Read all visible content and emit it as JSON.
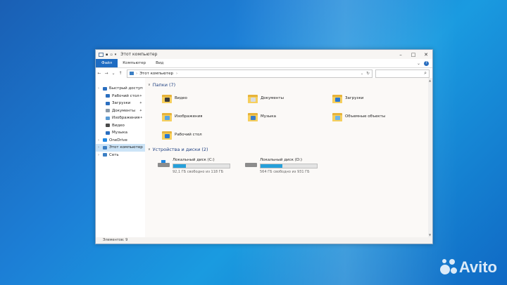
{
  "window": {
    "title": "Этот компьютер",
    "ribbon_tabs": [
      "Файл",
      "Компьютер",
      "Вид"
    ],
    "address": "Этот компьютер",
    "status": "Элементов: 9"
  },
  "nav": {
    "items": [
      {
        "label": "Быстрый доступ",
        "icon": "star-icon",
        "color": "#2b6fc0",
        "child": false,
        "pinned": false,
        "selected": false,
        "arrow": "›"
      },
      {
        "label": "Рабочий стол",
        "icon": "desktop-icon",
        "color": "#2b6fc0",
        "child": true,
        "pinned": true,
        "selected": false,
        "arrow": ""
      },
      {
        "label": "Загрузки",
        "icon": "download-icon",
        "color": "#2b6fc0",
        "child": true,
        "pinned": true,
        "selected": false,
        "arrow": ""
      },
      {
        "label": "Документы",
        "icon": "documents-icon",
        "color": "#8c9aa8",
        "child": true,
        "pinned": true,
        "selected": false,
        "arrow": ""
      },
      {
        "label": "Изображения",
        "icon": "pictures-icon",
        "color": "#5a9bd5",
        "child": true,
        "pinned": true,
        "selected": false,
        "arrow": ""
      },
      {
        "label": "Видео",
        "icon": "video-icon",
        "color": "#4a4a4a",
        "child": true,
        "pinned": false,
        "selected": false,
        "arrow": ""
      },
      {
        "label": "Музыка",
        "icon": "music-icon",
        "color": "#2b6fc0",
        "child": true,
        "pinned": false,
        "selected": false,
        "arrow": ""
      },
      {
        "label": "OneDrive",
        "icon": "cloud-icon",
        "color": "#1e88e5",
        "child": false,
        "pinned": false,
        "selected": false,
        "arrow": "›"
      },
      {
        "label": "Этот компьютер",
        "icon": "computer-icon",
        "color": "#3c7fc4",
        "child": false,
        "pinned": false,
        "selected": true,
        "arrow": "›"
      },
      {
        "label": "Сеть",
        "icon": "network-icon",
        "color": "#3c7fc4",
        "child": false,
        "pinned": false,
        "selected": false,
        "arrow": "›"
      }
    ]
  },
  "folders_section": {
    "title": "Папки (7)",
    "items": [
      {
        "label": "Видео",
        "icon": "video-folder-icon",
        "badge": "#3b3b3b"
      },
      {
        "label": "Документы",
        "icon": "documents-folder-icon",
        "badge": "#d8dce2"
      },
      {
        "label": "Загрузки",
        "icon": "downloads-folder-icon",
        "badge": "#2b78d0"
      },
      {
        "label": "Изображения",
        "icon": "pictures-folder-icon",
        "badge": "#5aa5e0"
      },
      {
        "label": "Музыка",
        "icon": "music-folder-icon",
        "badge": "#3a7cc8"
      },
      {
        "label": "Объемные объекты",
        "icon": "3d-objects-folder-icon",
        "badge": "#6fb5e6"
      },
      {
        "label": "Рабочий стол",
        "icon": "desktop-folder-icon",
        "badge": "#2b78d0"
      }
    ]
  },
  "drives_section": {
    "title": "Устройства и диски (2)",
    "items": [
      {
        "label": "Локальный диск (C:)",
        "free": "92,1 ГБ свободно из 118 ГБ",
        "used_fraction": 0.22,
        "icon": "windows-drive-icon"
      },
      {
        "label": "Локальный диск (D:)",
        "free": "564 ГБ свободно из 931 ГБ",
        "used_fraction": 0.39,
        "icon": "drive-icon"
      }
    ]
  },
  "watermark": "Avito",
  "colors": {
    "accent": "#1e6cc2",
    "selection": "#cce4f7",
    "drive_bar": "#26a0da",
    "folder": "#f6cf5d"
  }
}
